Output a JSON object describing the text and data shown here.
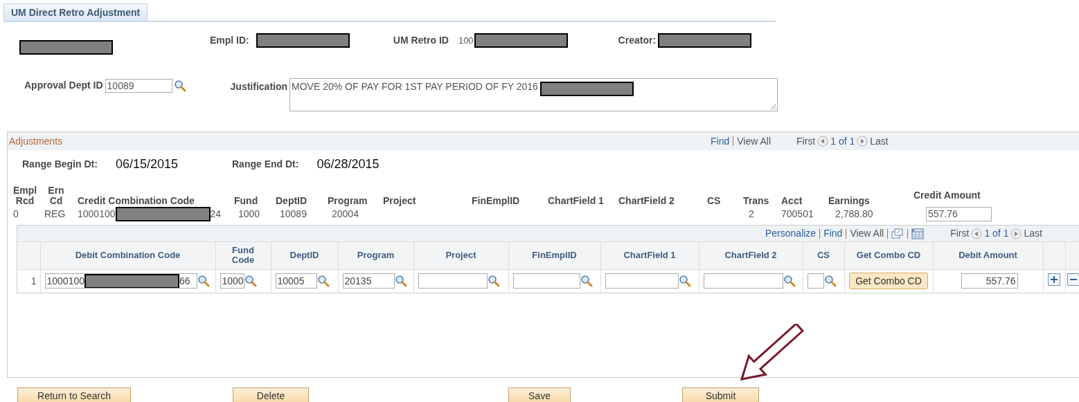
{
  "tab": {
    "label": "UM Direct Retro Adjustment",
    "selected": true
  },
  "header_fields": [
    {
      "label": "Empl ID:"
    },
    {
      "label": "UM Retro ID",
      "value": "100"
    },
    {
      "label": "Creator:"
    }
  ],
  "approval_dept": {
    "label": "Approval Dept ID",
    "value": "10089"
  },
  "justification": {
    "label": "Justification",
    "value": "MOVE 20% OF PAY FOR 1ST PAY PERIOD OF FY 2016"
  },
  "adjustments": {
    "title": "Adjustments",
    "nav": {
      "find": "Find",
      "view_all": "View All",
      "first": "First",
      "count": "1 of 1",
      "last": "Last"
    },
    "range": [
      {
        "label": "Range Begin Dt:",
        "value": "06/15/2015"
      },
      {
        "label": "Range End Dt:",
        "value": "06/28/2015"
      }
    ],
    "credit_columns": [
      {
        "header": "Empl Rcd",
        "kind": "text",
        "value": "0"
      },
      {
        "header": "Ern Cd",
        "kind": "text",
        "value": "REG"
      },
      {
        "header": "Credit Combination Code",
        "kind": "redacted",
        "start": "1000100",
        "end": "24"
      },
      {
        "header": "Fund",
        "kind": "text",
        "value": "1000"
      },
      {
        "header": "DeptID",
        "kind": "text",
        "value": "10089"
      },
      {
        "header": "Program",
        "kind": "text",
        "value": "20004"
      },
      {
        "header": "Project",
        "kind": "text"
      },
      {
        "header": "FinEmplID",
        "kind": "text"
      },
      {
        "header": "ChartField 1",
        "kind": "text"
      },
      {
        "header": "ChartField 2",
        "kind": "text"
      },
      {
        "header": "CS",
        "kind": "text"
      },
      {
        "header": "Trans",
        "kind": "text",
        "value": "2"
      },
      {
        "header": "Acct",
        "kind": "text",
        "value": "700501"
      },
      {
        "header": "Earnings",
        "kind": "text",
        "value": "2,788.80"
      },
      {
        "header": "Credit Amount",
        "kind": "input",
        "value": "557.76"
      }
    ]
  },
  "debit_grid": {
    "nav": {
      "personalize": "Personalize",
      "find": "Find",
      "view_all": "View All",
      "first": "First",
      "count": "1 of 1",
      "last": "Last"
    },
    "columns": [
      "Debit Combination Code",
      "Fund Code",
      "DeptID",
      "Program",
      "Project",
      "FinEmplID",
      "ChartField 1",
      "ChartField 2",
      "CS",
      "Get Combo CD",
      "Debit Amount"
    ],
    "rows": [
      {
        "number": "1",
        "cells": [
          {
            "kind": "redacted_lookup",
            "start": "1000100",
            "end": "66"
          },
          {
            "kind": "lookup",
            "value": "1000"
          },
          {
            "kind": "lookup",
            "value": "10005"
          },
          {
            "kind": "lookup",
            "value": "20135"
          },
          {
            "kind": "lookup"
          },
          {
            "kind": "lookup"
          },
          {
            "kind": "lookup"
          },
          {
            "kind": "lookup"
          },
          {
            "kind": "lookup"
          },
          {
            "kind": "button",
            "label": "Get Combo CD"
          },
          {
            "kind": "amount",
            "value": "557.76"
          }
        ]
      }
    ]
  },
  "buttons": [
    "Return to Search",
    "Delete",
    "Save",
    "Submit"
  ]
}
